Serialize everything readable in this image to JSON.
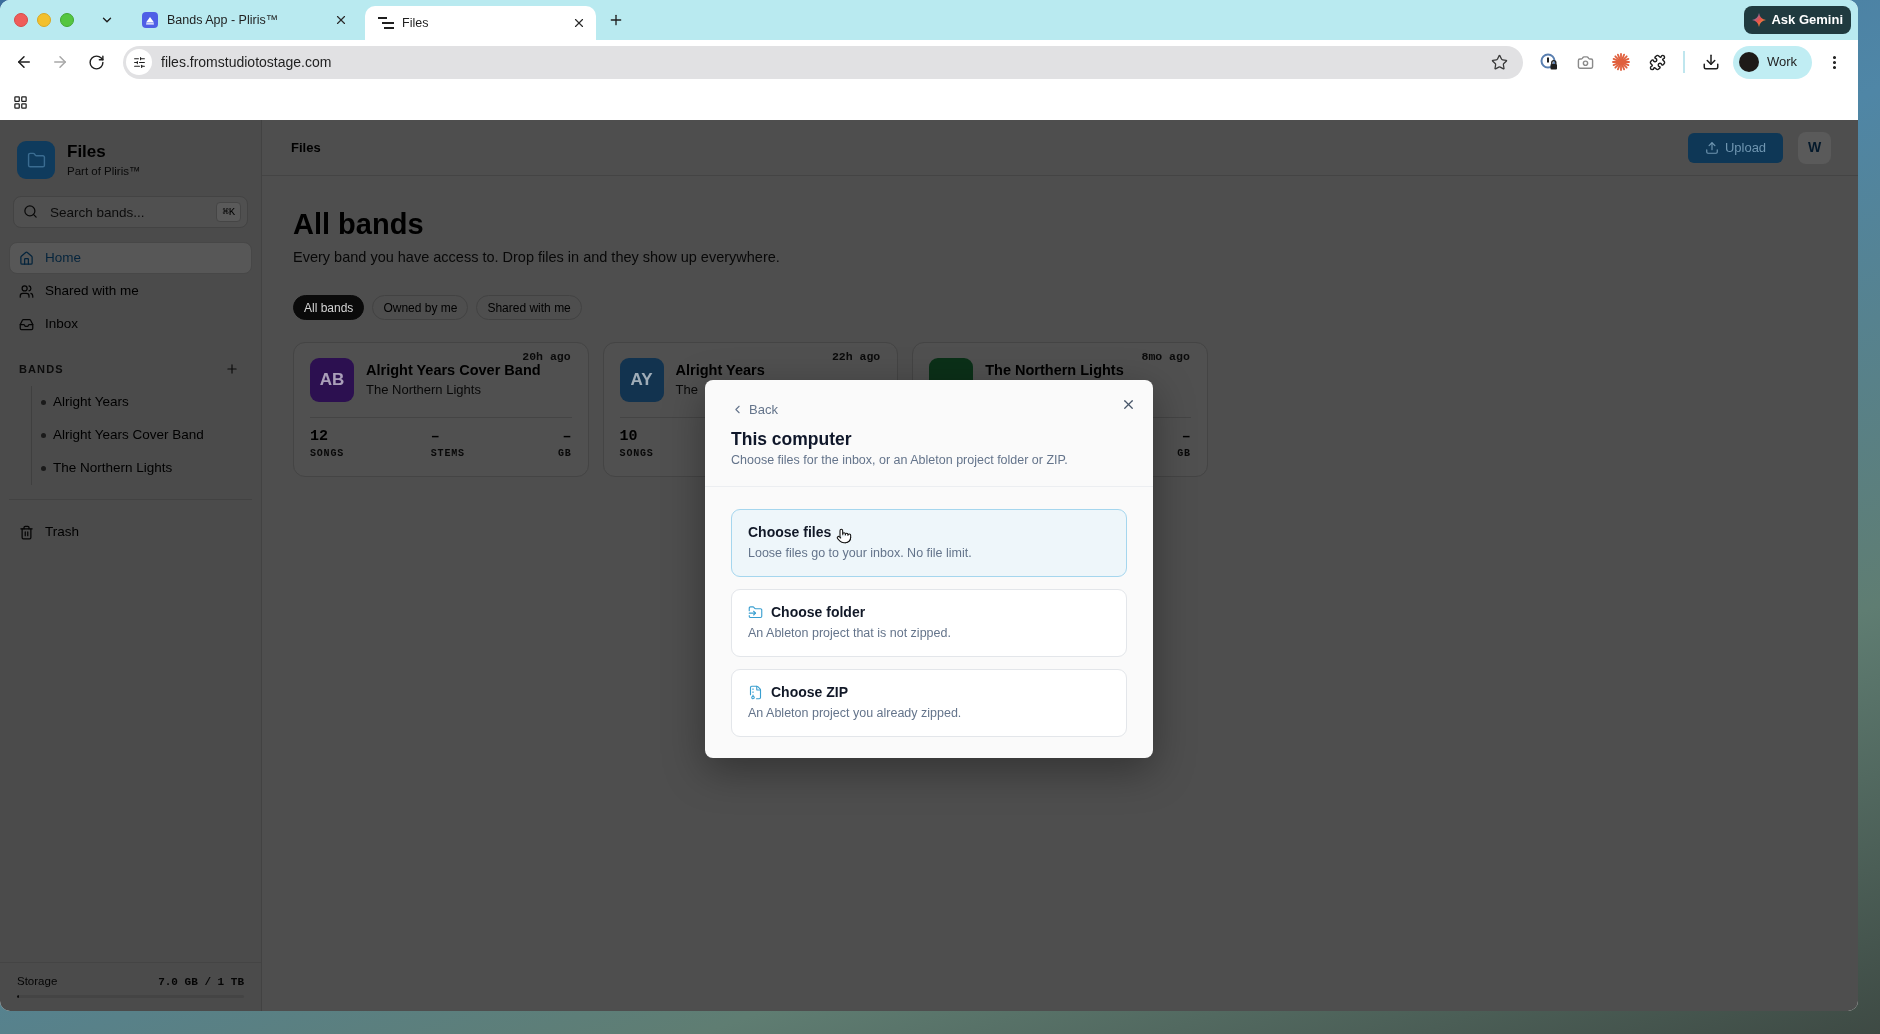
{
  "browser": {
    "tabs": [
      {
        "kind": "app",
        "title": "Bands App - Pliris™",
        "selected": false
      },
      {
        "kind": "lines",
        "title": "Files",
        "selected": true
      }
    ],
    "assistant_button": "Ask Gemini",
    "address": "files.fromstudiotostage.com",
    "profile": "Work"
  },
  "sidebar": {
    "title": "Files",
    "subtitle": "Part of Pliris™",
    "search": {
      "placeholder": "Search bands...",
      "shortcut": "⌘K"
    },
    "nav": [
      {
        "kind": "home",
        "label": "Home",
        "selected": true
      },
      {
        "kind": "users",
        "label": "Shared with me",
        "selected": false
      },
      {
        "kind": "inbox",
        "label": "Inbox",
        "selected": false
      }
    ],
    "bands_heading": "BANDS",
    "bands": [
      "Alright Years",
      "Alright Years Cover Band",
      "The Northern Lights"
    ],
    "trash": "Trash",
    "storage": {
      "label": "Storage",
      "reading": "7.0 GB / 1 TB",
      "level": 0.01
    }
  },
  "header": {
    "breadcrumb": "Files",
    "upload_button": "Upload",
    "avatar": "W"
  },
  "page": {
    "title": "All bands",
    "subtitle": "Every band you have access to. Drop files in and they show up everywhere.",
    "filters": [
      {
        "label": "All bands",
        "selected": true
      },
      {
        "label": "Owned by me",
        "selected": false
      },
      {
        "label": "Shared with me",
        "selected": false
      }
    ],
    "cards": [
      {
        "initials": "AB",
        "color": "#2c1050",
        "title": "Alright Years Cover Band",
        "subtitle": "The Northern Lights",
        "time": "20h ago",
        "stats": [
          {
            "kind": "songs",
            "value": "12",
            "label": "SONGS"
          },
          {
            "kind": "stems",
            "value": "–",
            "label": "STEMS"
          },
          {
            "kind": "gb",
            "value": "–",
            "label": "GB"
          }
        ]
      },
      {
        "initials": "AY",
        "color": "#12334f",
        "title": "Alright Years",
        "subtitle": "The",
        "time": "22h ago",
        "stats": [
          {
            "kind": "songs",
            "value": "10",
            "label": "SONGS"
          }
        ]
      },
      {
        "color": "#0b3018",
        "title": "The Northern Lights",
        "time": "8mo ago",
        "stats": [
          {
            "kind": "gb",
            "value": "–",
            "label": "GB"
          }
        ]
      }
    ]
  },
  "dialog": {
    "back": "Back",
    "title": "This computer",
    "subtitle": "Choose files for the inbox, or an Ableton project folder or ZIP.",
    "options": [
      {
        "kind": "files",
        "title": "Choose files",
        "description": "Loose files go to your inbox. No file limit.",
        "selected": true
      },
      {
        "kind": "folder",
        "title": "Choose folder",
        "description": "An Ableton project that is not zipped.",
        "selected": false
      },
      {
        "kind": "zip",
        "title": "Choose ZIP",
        "description": "An Ableton project you already zipped.",
        "selected": false
      }
    ]
  }
}
